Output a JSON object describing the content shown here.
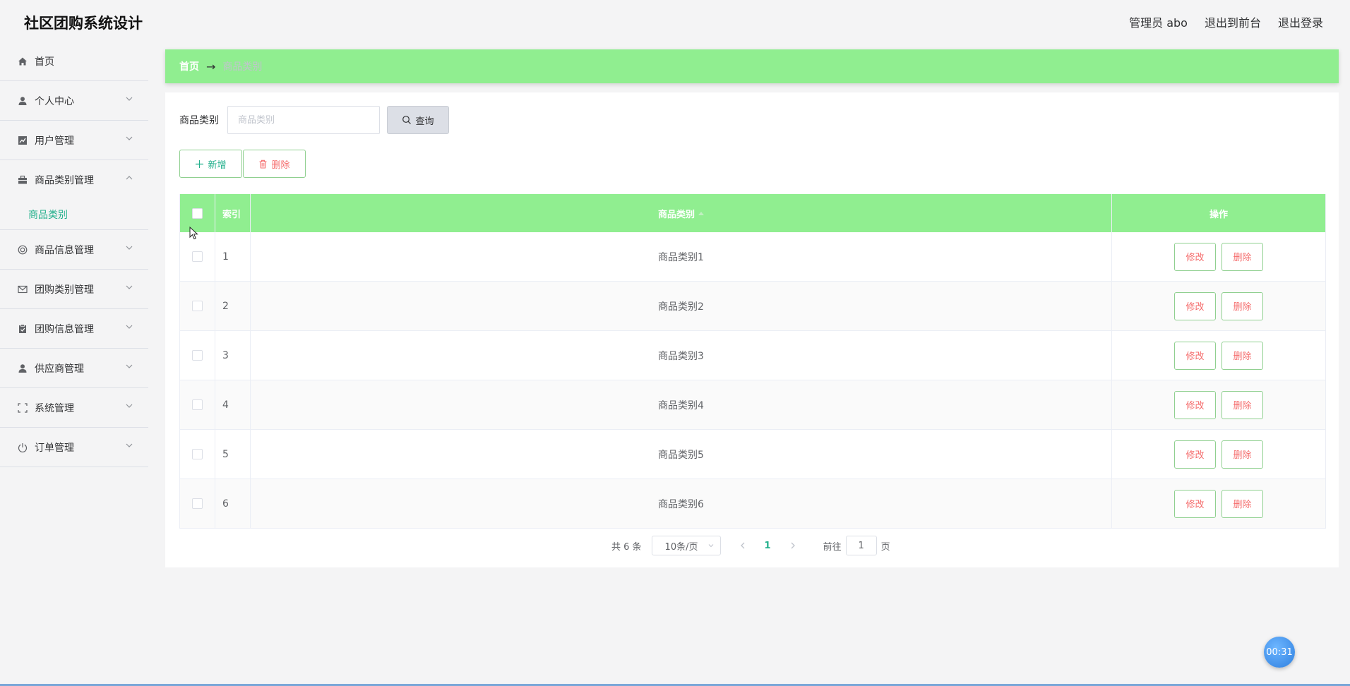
{
  "header": {
    "app_title": "社区团购系统设计",
    "user_label": "管理员 abo",
    "to_front_label": "退出到前台",
    "logout_label": "退出登录"
  },
  "sidebar": {
    "items": [
      {
        "label": "首页",
        "icon": "home-icon"
      },
      {
        "label": "个人中心",
        "icon": "user-icon"
      },
      {
        "label": "用户管理",
        "icon": "chart-icon"
      },
      {
        "label": "商品类别管理",
        "icon": "briefcase-icon",
        "expanded": true,
        "children": [
          "商品类别"
        ]
      },
      {
        "label": "商品信息管理",
        "icon": "lifebuoy-icon"
      },
      {
        "label": "团购类别管理",
        "icon": "mail-icon"
      },
      {
        "label": "团购信息管理",
        "icon": "clipboard-icon"
      },
      {
        "label": "供应商管理",
        "icon": "user-icon"
      },
      {
        "label": "系统管理",
        "icon": "frame-icon"
      },
      {
        "label": "订单管理",
        "icon": "power-icon"
      }
    ]
  },
  "breadcrumb": {
    "home": "首页",
    "separator": "→",
    "current": "商品类别"
  },
  "search": {
    "label": "商品类别",
    "value": "",
    "placeholder": "商品类别",
    "button_label": "查询"
  },
  "actions": {
    "add_label": "新增",
    "delete_label": "删除"
  },
  "table": {
    "columns": {
      "index": "索引",
      "category": "商品类别",
      "operation": "操作"
    },
    "rows": [
      {
        "index": "1",
        "category": "商品类别1"
      },
      {
        "index": "2",
        "category": "商品类别2"
      },
      {
        "index": "3",
        "category": "商品类别3"
      },
      {
        "index": "4",
        "category": "商品类别4"
      },
      {
        "index": "5",
        "category": "商品类别5"
      },
      {
        "index": "6",
        "category": "商品类别6"
      }
    ],
    "edit_label": "修改",
    "delete_label": "删除"
  },
  "pagination": {
    "total_text": "共 6 条",
    "page_size": "10条/页",
    "current_page": "1",
    "goto_prefix": "前往",
    "goto_value": "1",
    "goto_suffix": "页"
  },
  "timer": {
    "text": "00:31"
  },
  "colors": {
    "accent_green": "#90ee90",
    "active_text": "#23b08c",
    "danger": "#f56c6c"
  }
}
